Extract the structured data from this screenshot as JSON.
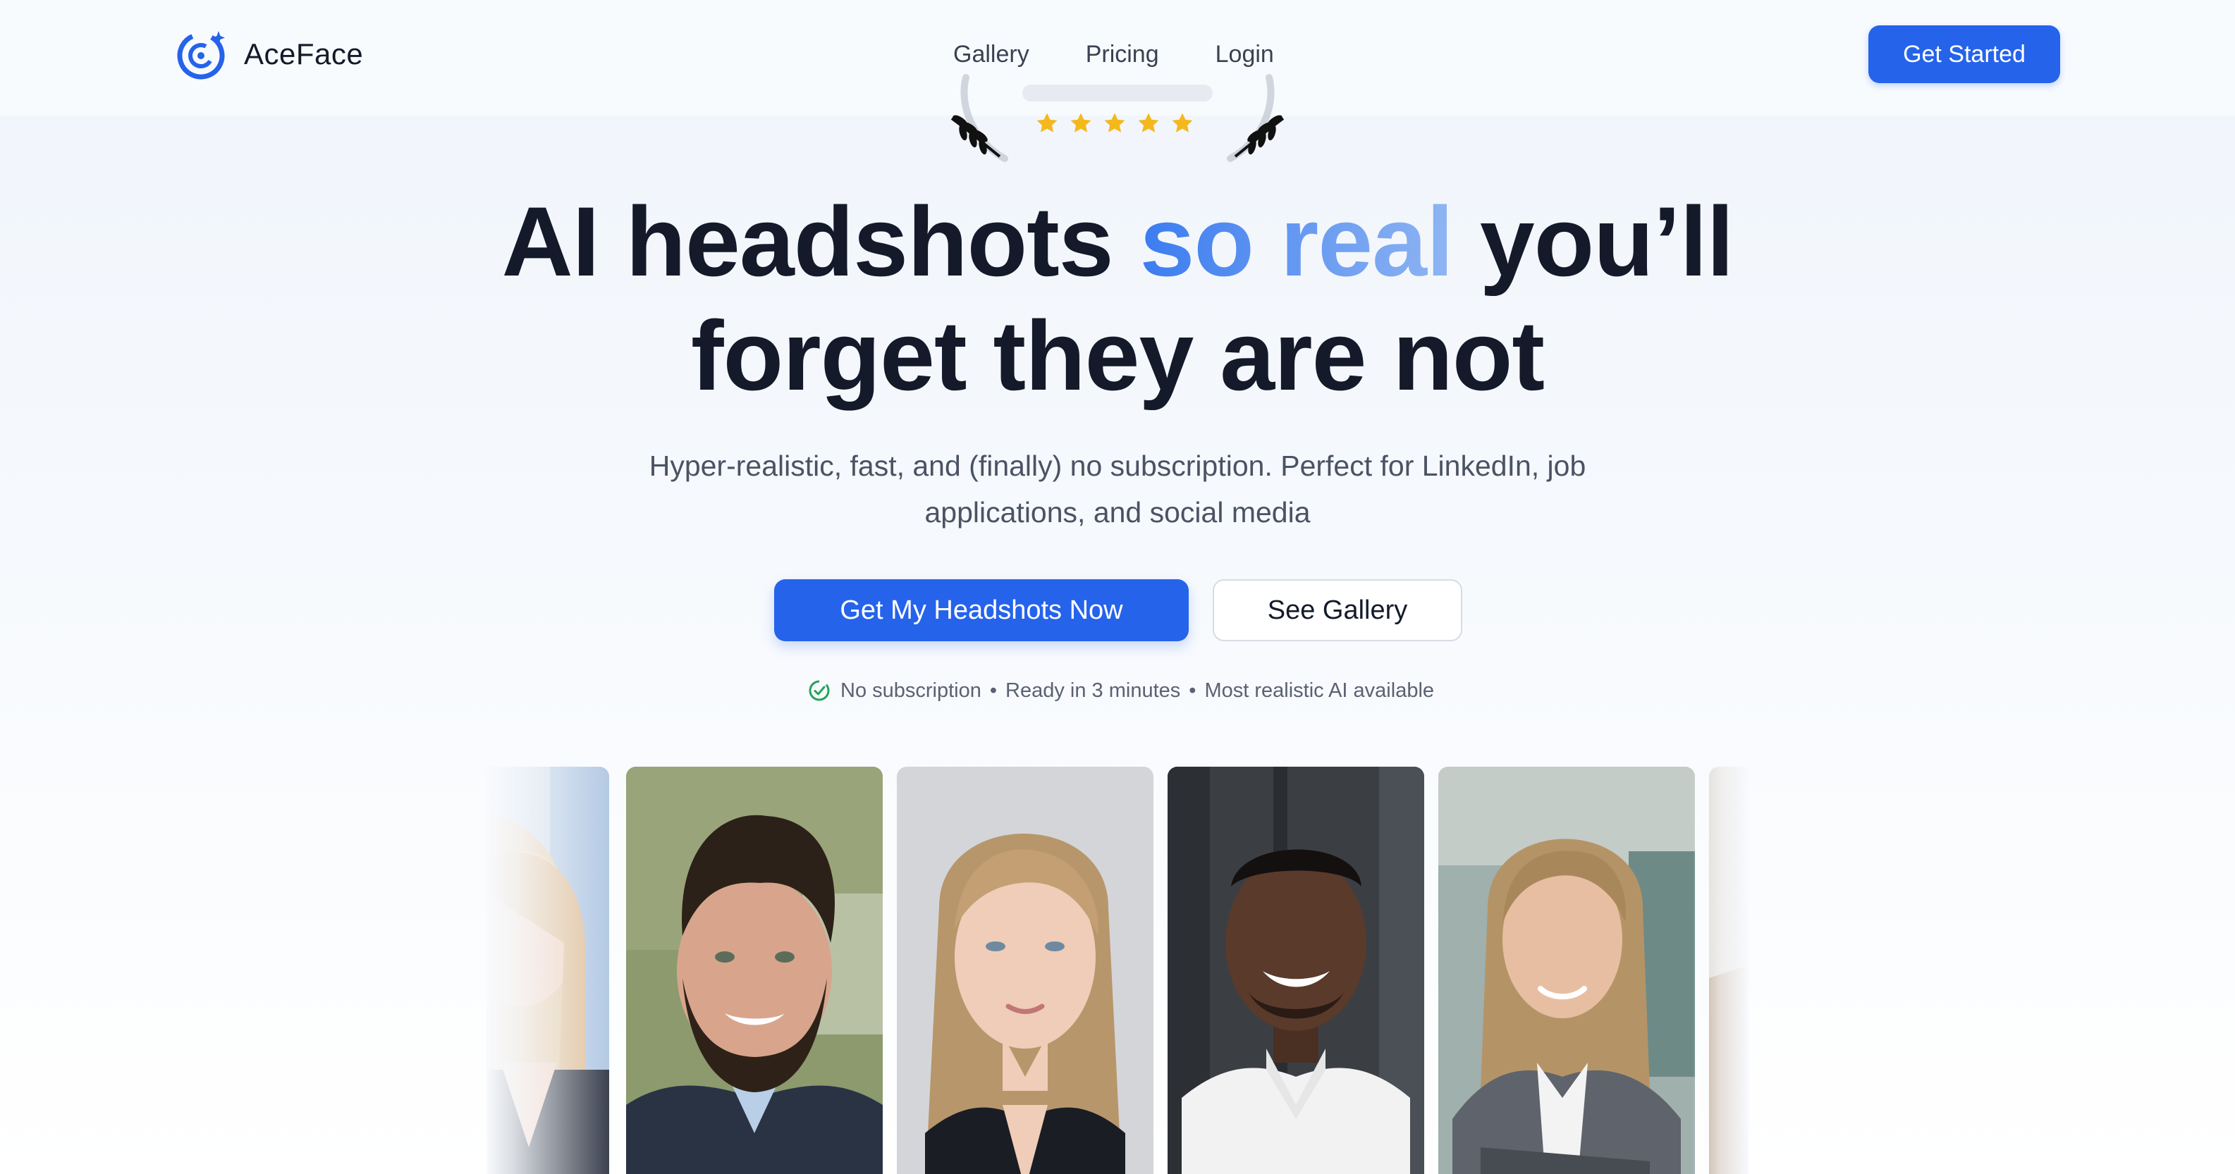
{
  "nav": {
    "brand": "AceFace",
    "links": [
      "Gallery",
      "Pricing",
      "Login"
    ],
    "cta": "Get Started"
  },
  "badge": {
    "rating_stars": 5
  },
  "hero": {
    "title_part1": "AI headshots ",
    "title_highlight": "so real",
    "title_part2": " you’ll forget they are not",
    "subtitle": "Hyper-realistic, fast, and (finally) no subscription. Perfect for LinkedIn, job applications, and social media",
    "primary_cta": "Get My Headshots Now",
    "secondary_cta": "See Gallery",
    "features": [
      "No subscription",
      "Ready in 3 minutes",
      "Most realistic AI available"
    ]
  },
  "colors": {
    "accent": "#2563eb",
    "star": "#f5b81c",
    "check": "#22a55a"
  }
}
